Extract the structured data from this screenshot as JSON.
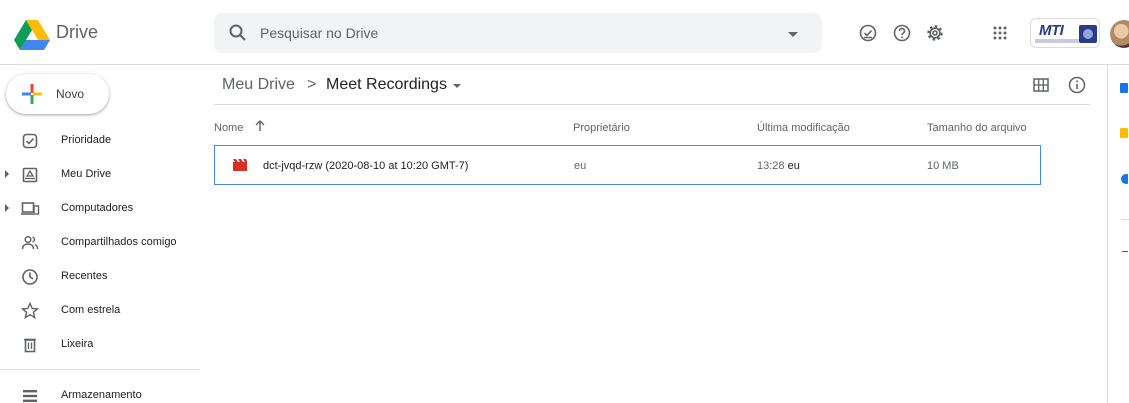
{
  "header": {
    "app_name": "Drive",
    "search_placeholder": "Pesquisar no Drive",
    "brand_text": "MTI"
  },
  "sidebar": {
    "new_label": "Novo",
    "items": [
      {
        "label": "Prioridade",
        "icon": "priority-icon"
      },
      {
        "label": "Meu Drive",
        "icon": "my-drive-icon"
      },
      {
        "label": "Computadores",
        "icon": "computers-icon"
      },
      {
        "label": "Compartilhados comigo",
        "icon": "shared-icon"
      },
      {
        "label": "Recentes",
        "icon": "clock-icon"
      },
      {
        "label": "Com estrela",
        "icon": "star-icon"
      },
      {
        "label": "Lixeira",
        "icon": "trash-icon"
      },
      {
        "label": "Armazenamento",
        "icon": "storage-icon"
      }
    ]
  },
  "breadcrumb": {
    "root": "Meu Drive",
    "separator": ">",
    "current": "Meet Recordings"
  },
  "table": {
    "columns": [
      "Nome",
      "Proprietário",
      "Última modificação",
      "Tamanho do arquivo"
    ],
    "rows": [
      {
        "name": "dct-jvqd-rzw (2020-08-10 at 10:20 GMT-7)",
        "owner": "eu",
        "modified_time": "13:28",
        "modified_by": "eu",
        "size": "10 MB"
      }
    ]
  },
  "colors": {
    "accent": "#4285f4",
    "text": "#202124",
    "muted": "#5f6368",
    "divider": "#dadce0",
    "video": "#d93025"
  }
}
